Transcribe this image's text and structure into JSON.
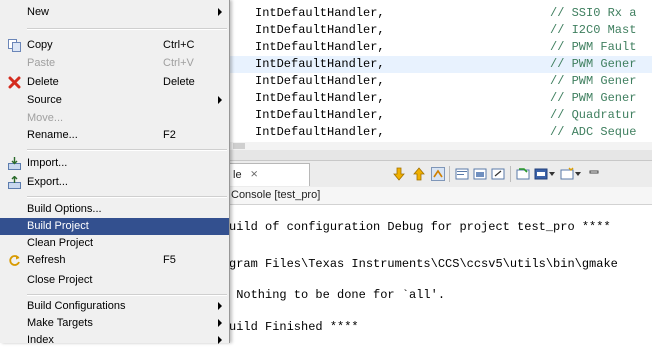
{
  "editor": {
    "lines": [
      {
        "code": "IntDefaultHandler,",
        "comment": "// SSI0 Rx a"
      },
      {
        "code": "IntDefaultHandler,",
        "comment": "// I2C0 Mast"
      },
      {
        "code": "IntDefaultHandler,",
        "comment": "// PWM Fault"
      },
      {
        "code": "IntDefaultHandler,",
        "comment": "// PWM Gener"
      },
      {
        "code": "IntDefaultHandler,",
        "comment": "// PWM Gener"
      },
      {
        "code": "IntDefaultHandler,",
        "comment": "// PWM Gener"
      },
      {
        "code": "IntDefaultHandler,",
        "comment": "// Quadratur"
      },
      {
        "code": "IntDefaultHandler,",
        "comment": "// ADC Seque"
      }
    ]
  },
  "console": {
    "tab_label": "le",
    "tab_close": "⨯",
    "title": "Console [test_pro]",
    "lines": [
      "uild of configuration Debug for project test_pro ****",
      "gram Files\\Texas Instruments\\CCS\\ccsv5\\utils\\bin\\gmake",
      " Nothing to be done for `all'.",
      "uild Finished ****"
    ]
  },
  "menu": {
    "items": [
      {
        "label": "New",
        "shortcut": "",
        "submenu": true
      },
      {
        "label": "Copy",
        "shortcut": "Ctrl+C",
        "icon": "copy-icon"
      },
      {
        "label": "Paste",
        "shortcut": "Ctrl+V",
        "disabled": true
      },
      {
        "label": "Delete",
        "shortcut": "Delete",
        "icon": "delete-icon"
      },
      {
        "label": "Source",
        "shortcut": "",
        "submenu": true
      },
      {
        "label": "Move...",
        "shortcut": "",
        "disabled": true
      },
      {
        "label": "Rename...",
        "shortcut": "F2"
      },
      {
        "label": "Import...",
        "shortcut": "",
        "icon": "import-icon"
      },
      {
        "label": "Export...",
        "shortcut": "",
        "icon": "export-icon"
      },
      {
        "label": "Build Options...",
        "shortcut": ""
      },
      {
        "label": "Build Project",
        "shortcut": "",
        "selected": true
      },
      {
        "label": "Clean Project",
        "shortcut": ""
      },
      {
        "label": "Refresh",
        "shortcut": "F5",
        "icon": "refresh-icon"
      },
      {
        "label": "Close Project",
        "shortcut": ""
      },
      {
        "label": "Build Configurations",
        "shortcut": "",
        "submenu": true
      },
      {
        "label": "Make Targets",
        "shortcut": "",
        "submenu": true
      },
      {
        "label": "Index",
        "shortcut": "",
        "submenu": true
      }
    ]
  },
  "colors": {
    "selection": "#33508f",
    "menu_bg": "#f0f0f0",
    "comment": "#3f7f5f",
    "line_highlight": "#e8f2fe"
  }
}
